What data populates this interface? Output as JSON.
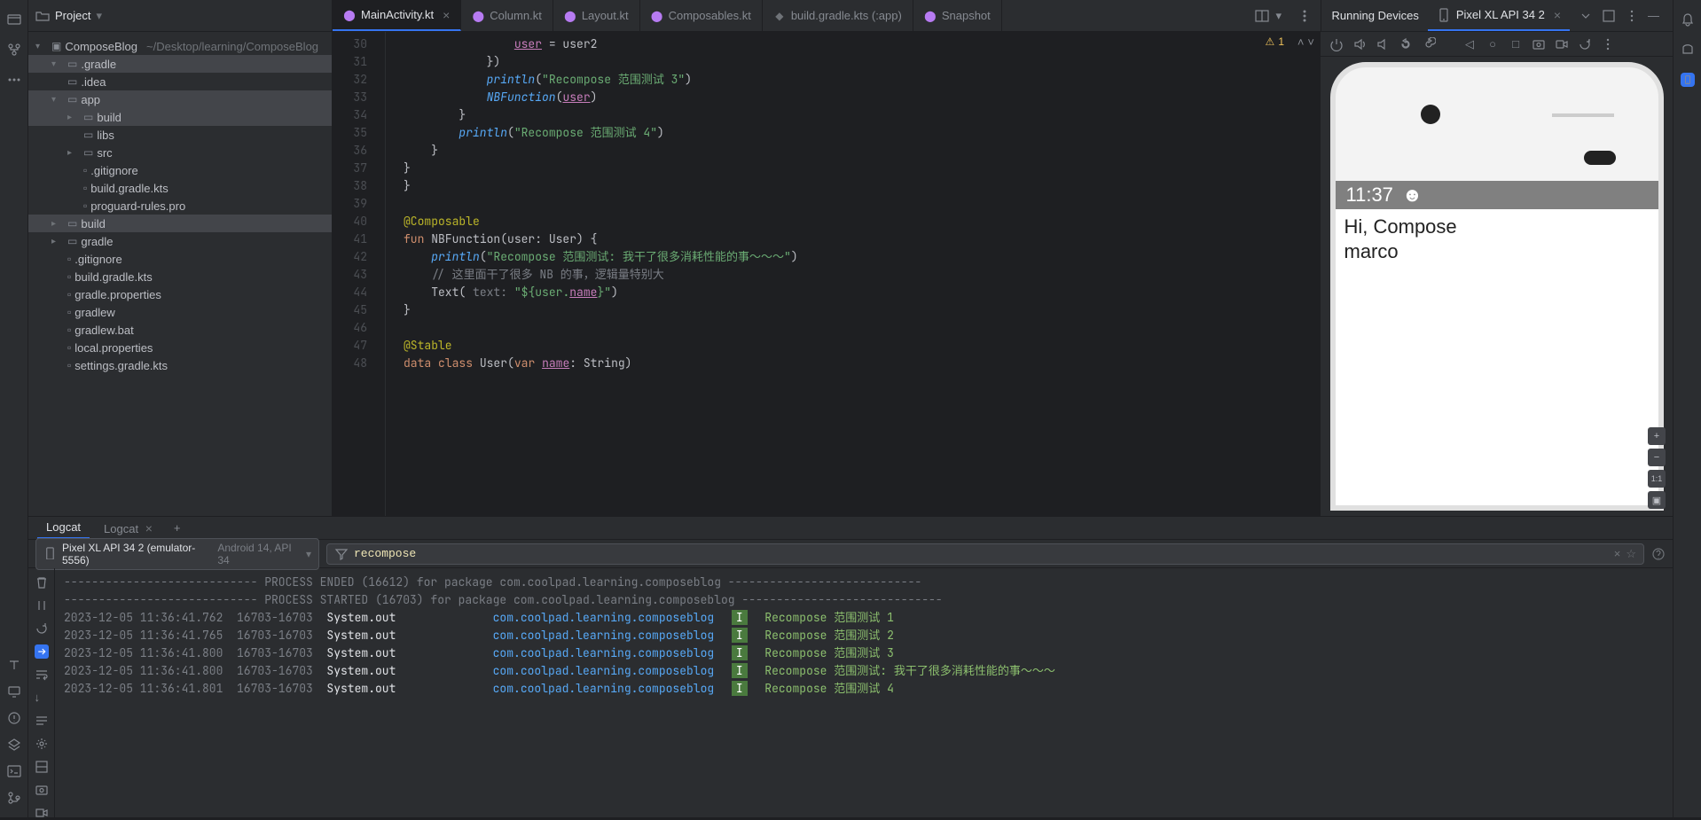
{
  "project_header": {
    "title": "Project"
  },
  "tree": {
    "root": {
      "label": "ComposeBlog",
      "path": "~/Desktop/learning/ComposeBlog"
    },
    "items": [
      {
        "indent": 1,
        "chev": "▾",
        "icon": "folder",
        "label": ".gradle",
        "hl": true
      },
      {
        "indent": 1,
        "chev": "",
        "icon": "folder",
        "label": ".idea"
      },
      {
        "indent": 1,
        "chev": "▾",
        "icon": "folder",
        "label": "app",
        "hl": true
      },
      {
        "indent": 2,
        "chev": "▸",
        "icon": "folder",
        "label": "build",
        "hl": true
      },
      {
        "indent": 2,
        "chev": "",
        "icon": "folder",
        "label": "libs"
      },
      {
        "indent": 2,
        "chev": "▸",
        "icon": "folder",
        "label": "src"
      },
      {
        "indent": 2,
        "chev": "",
        "icon": "file",
        "label": ".gitignore"
      },
      {
        "indent": 2,
        "chev": "",
        "icon": "gradle",
        "label": "build.gradle.kts"
      },
      {
        "indent": 2,
        "chev": "",
        "icon": "file",
        "label": "proguard-rules.pro"
      },
      {
        "indent": 1,
        "chev": "▸",
        "icon": "folder",
        "label": "build",
        "hl": true
      },
      {
        "indent": 1,
        "chev": "▸",
        "icon": "folder",
        "label": "gradle"
      },
      {
        "indent": 1,
        "chev": "",
        "icon": "file",
        "label": ".gitignore"
      },
      {
        "indent": 1,
        "chev": "",
        "icon": "gradle",
        "label": "build.gradle.kts"
      },
      {
        "indent": 1,
        "chev": "",
        "icon": "file",
        "label": "gradle.properties"
      },
      {
        "indent": 1,
        "chev": "",
        "icon": "file",
        "label": "gradlew"
      },
      {
        "indent": 1,
        "chev": "",
        "icon": "file",
        "label": "gradlew.bat"
      },
      {
        "indent": 1,
        "chev": "",
        "icon": "file",
        "label": "local.properties"
      },
      {
        "indent": 1,
        "chev": "",
        "icon": "gradle",
        "label": "settings.gradle.kts"
      }
    ]
  },
  "editor_tabs": [
    {
      "label": "MainActivity.kt",
      "icon": "kt",
      "active": true,
      "closable": true
    },
    {
      "label": "Column.kt",
      "icon": "kt"
    },
    {
      "label": "Layout.kt",
      "icon": "kt"
    },
    {
      "label": "Composables.kt",
      "icon": "kt"
    },
    {
      "label": "build.gradle.kts (:app)",
      "icon": "gradle"
    },
    {
      "label": "Snapshot",
      "icon": "kt"
    }
  ],
  "editor": {
    "warning_count": "1",
    "lines": [
      {
        "n": 30,
        "html": "                <span class='tok-var'>user</span> = user2"
      },
      {
        "n": 31,
        "html": "            })"
      },
      {
        "n": 32,
        "html": "            <span class='tok-func'>println</span>(<span class='tok-string'>\"Recompose 范围测试 3\"</span>)"
      },
      {
        "n": 33,
        "html": "            <span class='tok-func'>NBFunction</span>(<span class='tok-var'>user</span>)"
      },
      {
        "n": 34,
        "html": "        }"
      },
      {
        "n": 35,
        "html": "        <span class='tok-func'>println</span>(<span class='tok-string'>\"Recompose 范围测试 4\"</span>)"
      },
      {
        "n": 36,
        "html": "    }"
      },
      {
        "n": 37,
        "html": "}"
      },
      {
        "n": 38,
        "html": "}"
      },
      {
        "n": 39,
        "html": ""
      },
      {
        "n": 40,
        "html": "<span class='tok-annotation'>@Composable</span>"
      },
      {
        "n": 41,
        "html": "<span class='tok-keyword'>fun</span> <span class='tok-type'>NBFunction</span>(user: User) {"
      },
      {
        "n": 42,
        "html": "    <span class='tok-func'>println</span>(<span class='tok-string'>\"Recompose 范围测试: 我干了很多消耗性能的事～～～\"</span>)"
      },
      {
        "n": 43,
        "html": "    <span class='tok-comment'>// 这里面干了很多 NB 的事，逻辑量特别大</span>"
      },
      {
        "n": 44,
        "html": "    Text( <span class='tok-comment'>text:</span> <span class='tok-string'>\"${user.</span><span class='tok-var'>name</span><span class='tok-string'>}\"</span>)"
      },
      {
        "n": 45,
        "html": "}"
      },
      {
        "n": 46,
        "html": ""
      },
      {
        "n": 47,
        "html": "<span class='tok-annotation'>@Stable</span>"
      },
      {
        "n": 48,
        "html": "<span class='tok-keyword'>data</span> <span class='tok-keyword'>class</span> User(<span class='tok-keyword'>var</span> <span class='tok-var'>name</span>: String)"
      }
    ]
  },
  "devices": {
    "header_label": "Running Devices",
    "tab_label": "Pixel XL API 34 2",
    "status_time": "11:37",
    "screen_line1": "Hi, Compose",
    "screen_line2": "marco",
    "zoom_label": "1:1"
  },
  "logcat": {
    "tab1": "Logcat",
    "tab2": "Logcat",
    "device": {
      "name": "Pixel XL API 34 2 (emulator-5556)",
      "api": "Android 14, API 34"
    },
    "filter": "recompose",
    "lines": [
      {
        "raw": "---------------------------- PROCESS ENDED (16612) for package com.coolpad.learning.composeblog ----------------------------"
      },
      {
        "raw": "---------------------------- PROCESS STARTED (16703) for package com.coolpad.learning.composeblog -----------------------------"
      },
      {
        "ts": "2023-12-05 11:36:41.762",
        "pid": "16703-16703",
        "tag": "System.out",
        "pkg": "com.coolpad.learning.composeblog",
        "lvl": "I",
        "msg": "Recompose 范围测试 1"
      },
      {
        "ts": "2023-12-05 11:36:41.765",
        "pid": "16703-16703",
        "tag": "System.out",
        "pkg": "com.coolpad.learning.composeblog",
        "lvl": "I",
        "msg": "Recompose 范围测试 2"
      },
      {
        "ts": "2023-12-05 11:36:41.800",
        "pid": "16703-16703",
        "tag": "System.out",
        "pkg": "com.coolpad.learning.composeblog",
        "lvl": "I",
        "msg": "Recompose 范围测试 3"
      },
      {
        "ts": "2023-12-05 11:36:41.800",
        "pid": "16703-16703",
        "tag": "System.out",
        "pkg": "com.coolpad.learning.composeblog",
        "lvl": "I",
        "msg": "Recompose 范围测试: 我干了很多消耗性能的事～～～"
      },
      {
        "ts": "2023-12-05 11:36:41.801",
        "pid": "16703-16703",
        "tag": "System.out",
        "pkg": "com.coolpad.learning.composeblog",
        "lvl": "I",
        "msg": "Recompose 范围测试 4"
      }
    ]
  }
}
